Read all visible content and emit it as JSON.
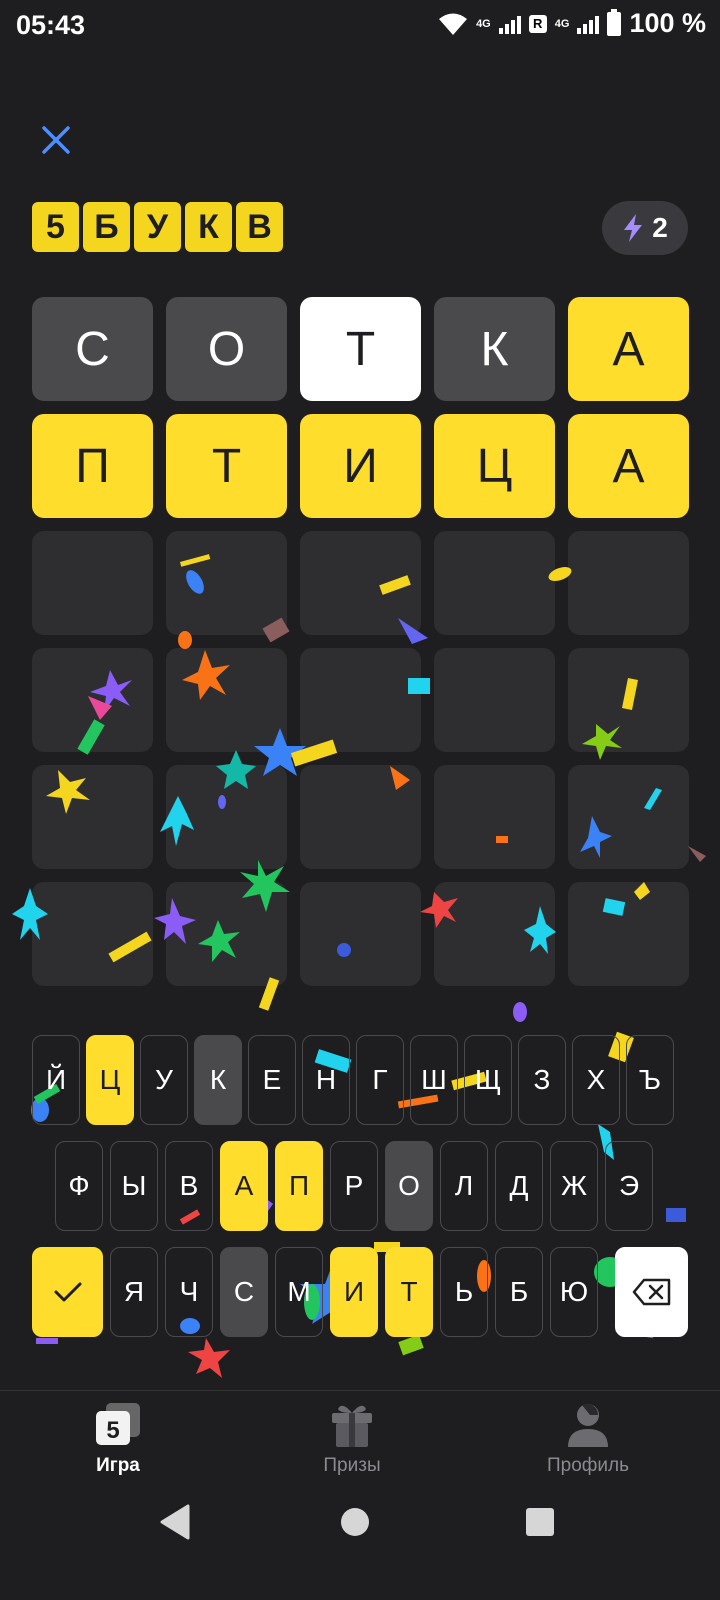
{
  "status_bar": {
    "time": "05:43",
    "network_1": "4G",
    "roaming": "R",
    "network_2": "4G",
    "battery": "100 %"
  },
  "header": {
    "logo_letters": [
      "5",
      "Б",
      "У",
      "К",
      "В"
    ],
    "energy_count": "2"
  },
  "board": {
    "rows": [
      [
        {
          "l": "С",
          "s": "gray"
        },
        {
          "l": "О",
          "s": "gray"
        },
        {
          "l": "Т",
          "s": "white"
        },
        {
          "l": "К",
          "s": "gray"
        },
        {
          "l": "А",
          "s": "yellow"
        }
      ],
      [
        {
          "l": "П",
          "s": "yellow"
        },
        {
          "l": "Т",
          "s": "yellow"
        },
        {
          "l": "И",
          "s": "yellow"
        },
        {
          "l": "Ц",
          "s": "yellow"
        },
        {
          "l": "А",
          "s": "yellow"
        }
      ],
      [
        {
          "l": "",
          "s": "empty"
        },
        {
          "l": "",
          "s": "empty"
        },
        {
          "l": "",
          "s": "empty"
        },
        {
          "l": "",
          "s": "empty"
        },
        {
          "l": "",
          "s": "empty"
        }
      ],
      [
        {
          "l": "",
          "s": "empty"
        },
        {
          "l": "",
          "s": "empty"
        },
        {
          "l": "",
          "s": "empty"
        },
        {
          "l": "",
          "s": "empty"
        },
        {
          "l": "",
          "s": "empty"
        }
      ],
      [
        {
          "l": "",
          "s": "empty"
        },
        {
          "l": "",
          "s": "empty"
        },
        {
          "l": "",
          "s": "empty"
        },
        {
          "l": "",
          "s": "empty"
        },
        {
          "l": "",
          "s": "empty"
        }
      ],
      [
        {
          "l": "",
          "s": "empty"
        },
        {
          "l": "",
          "s": "empty"
        },
        {
          "l": "",
          "s": "empty"
        },
        {
          "l": "",
          "s": "empty"
        },
        {
          "l": "",
          "s": "empty"
        }
      ]
    ]
  },
  "keyboard": {
    "row1": [
      {
        "k": "Й",
        "s": ""
      },
      {
        "k": "Ц",
        "s": "yellow"
      },
      {
        "k": "У",
        "s": ""
      },
      {
        "k": "К",
        "s": "gray"
      },
      {
        "k": "Е",
        "s": ""
      },
      {
        "k": "Н",
        "s": ""
      },
      {
        "k": "Г",
        "s": ""
      },
      {
        "k": "Ш",
        "s": ""
      },
      {
        "k": "Щ",
        "s": ""
      },
      {
        "k": "З",
        "s": ""
      },
      {
        "k": "Х",
        "s": ""
      },
      {
        "k": "Ъ",
        "s": ""
      }
    ],
    "row2": [
      {
        "k": "Ф",
        "s": ""
      },
      {
        "k": "Ы",
        "s": ""
      },
      {
        "k": "В",
        "s": ""
      },
      {
        "k": "А",
        "s": "yellow"
      },
      {
        "k": "П",
        "s": "yellow"
      },
      {
        "k": "Р",
        "s": ""
      },
      {
        "k": "О",
        "s": "gray"
      },
      {
        "k": "Л",
        "s": ""
      },
      {
        "k": "Д",
        "s": ""
      },
      {
        "k": "Ж",
        "s": ""
      },
      {
        "k": "Э",
        "s": ""
      }
    ],
    "row3": [
      {
        "k": "Я",
        "s": ""
      },
      {
        "k": "Ч",
        "s": ""
      },
      {
        "k": "С",
        "s": "gray"
      },
      {
        "k": "М",
        "s": ""
      },
      {
        "k": "И",
        "s": "yellow"
      },
      {
        "k": "Т",
        "s": "yellow"
      },
      {
        "k": "Ь",
        "s": ""
      },
      {
        "k": "Б",
        "s": ""
      },
      {
        "k": "Ю",
        "s": ""
      }
    ],
    "enter_icon": "check-icon",
    "backspace_icon": "backspace-icon"
  },
  "tabs": [
    {
      "label": "Игра",
      "icon": "game-icon",
      "active": true
    },
    {
      "label": "Призы",
      "icon": "gift-icon",
      "active": false
    },
    {
      "label": "Профиль",
      "icon": "profile-icon",
      "active": false
    }
  ],
  "colors": {
    "background": "#1e1e20",
    "yellow": "#ffdd2d",
    "gray": "#4a4a4d",
    "empty": "#2e2e31",
    "close": "#4c8dff",
    "bolt": "#a58cff"
  }
}
